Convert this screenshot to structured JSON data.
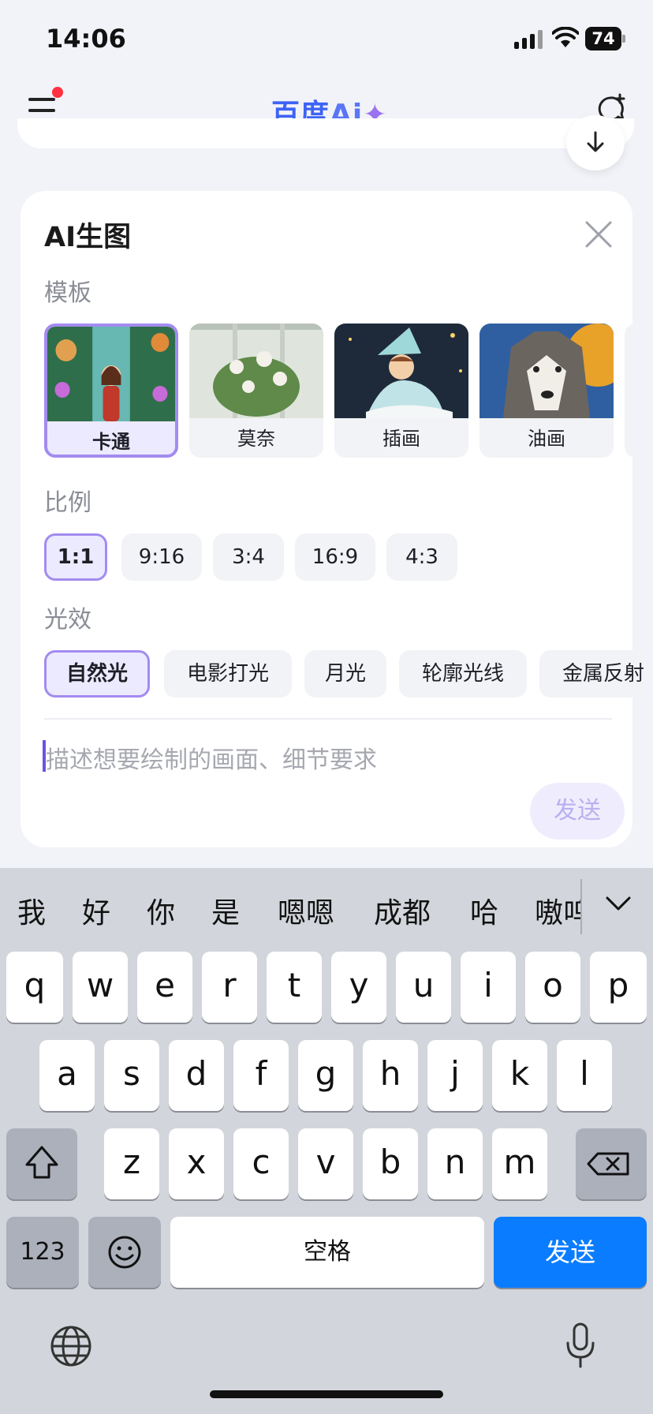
{
  "status_bar": {
    "time": "14:06",
    "battery": "74"
  },
  "nav": {
    "brand_main": "百度",
    "brand_ai": "Ai",
    "brand_plus": "✦"
  },
  "panel": {
    "title": "AI生图",
    "template_section": "模板",
    "templates": [
      {
        "label": "卡通",
        "selected": true
      },
      {
        "label": "莫奈",
        "selected": false
      },
      {
        "label": "插画",
        "selected": false
      },
      {
        "label": "油画",
        "selected": false
      }
    ],
    "ratio_section": "比例",
    "ratios": [
      {
        "label": "1:1",
        "selected": true
      },
      {
        "label": "9:16",
        "selected": false
      },
      {
        "label": "3:4",
        "selected": false
      },
      {
        "label": "16:9",
        "selected": false
      },
      {
        "label": "4:3",
        "selected": false
      }
    ],
    "light_section": "光效",
    "lights": [
      {
        "label": "自然光",
        "selected": true
      },
      {
        "label": "电影打光",
        "selected": false
      },
      {
        "label": "月光",
        "selected": false
      },
      {
        "label": "轮廓光线",
        "selected": false
      },
      {
        "label": "金属反射",
        "selected": false
      }
    ],
    "prompt_placeholder": "描述想要绘制的画面、细节要求",
    "send_label": "发送"
  },
  "keyboard": {
    "candidates": [
      "我",
      "好",
      "你",
      "是",
      "嗯嗯",
      "成都",
      "哈",
      "嗷呜"
    ],
    "row1": [
      "q",
      "w",
      "e",
      "r",
      "t",
      "y",
      "u",
      "i",
      "o",
      "p"
    ],
    "row2": [
      "a",
      "s",
      "d",
      "f",
      "g",
      "h",
      "j",
      "k",
      "l"
    ],
    "row3": [
      "z",
      "x",
      "c",
      "v",
      "b",
      "n",
      "m"
    ],
    "numbers_label": "123",
    "space_label": "空格",
    "send_label": "发送"
  },
  "colors": {
    "accent_purple": "#a38bf0",
    "brand_blue": "#3d63f5",
    "send_blue": "#0a7cff",
    "notification_red": "#ff3040"
  }
}
